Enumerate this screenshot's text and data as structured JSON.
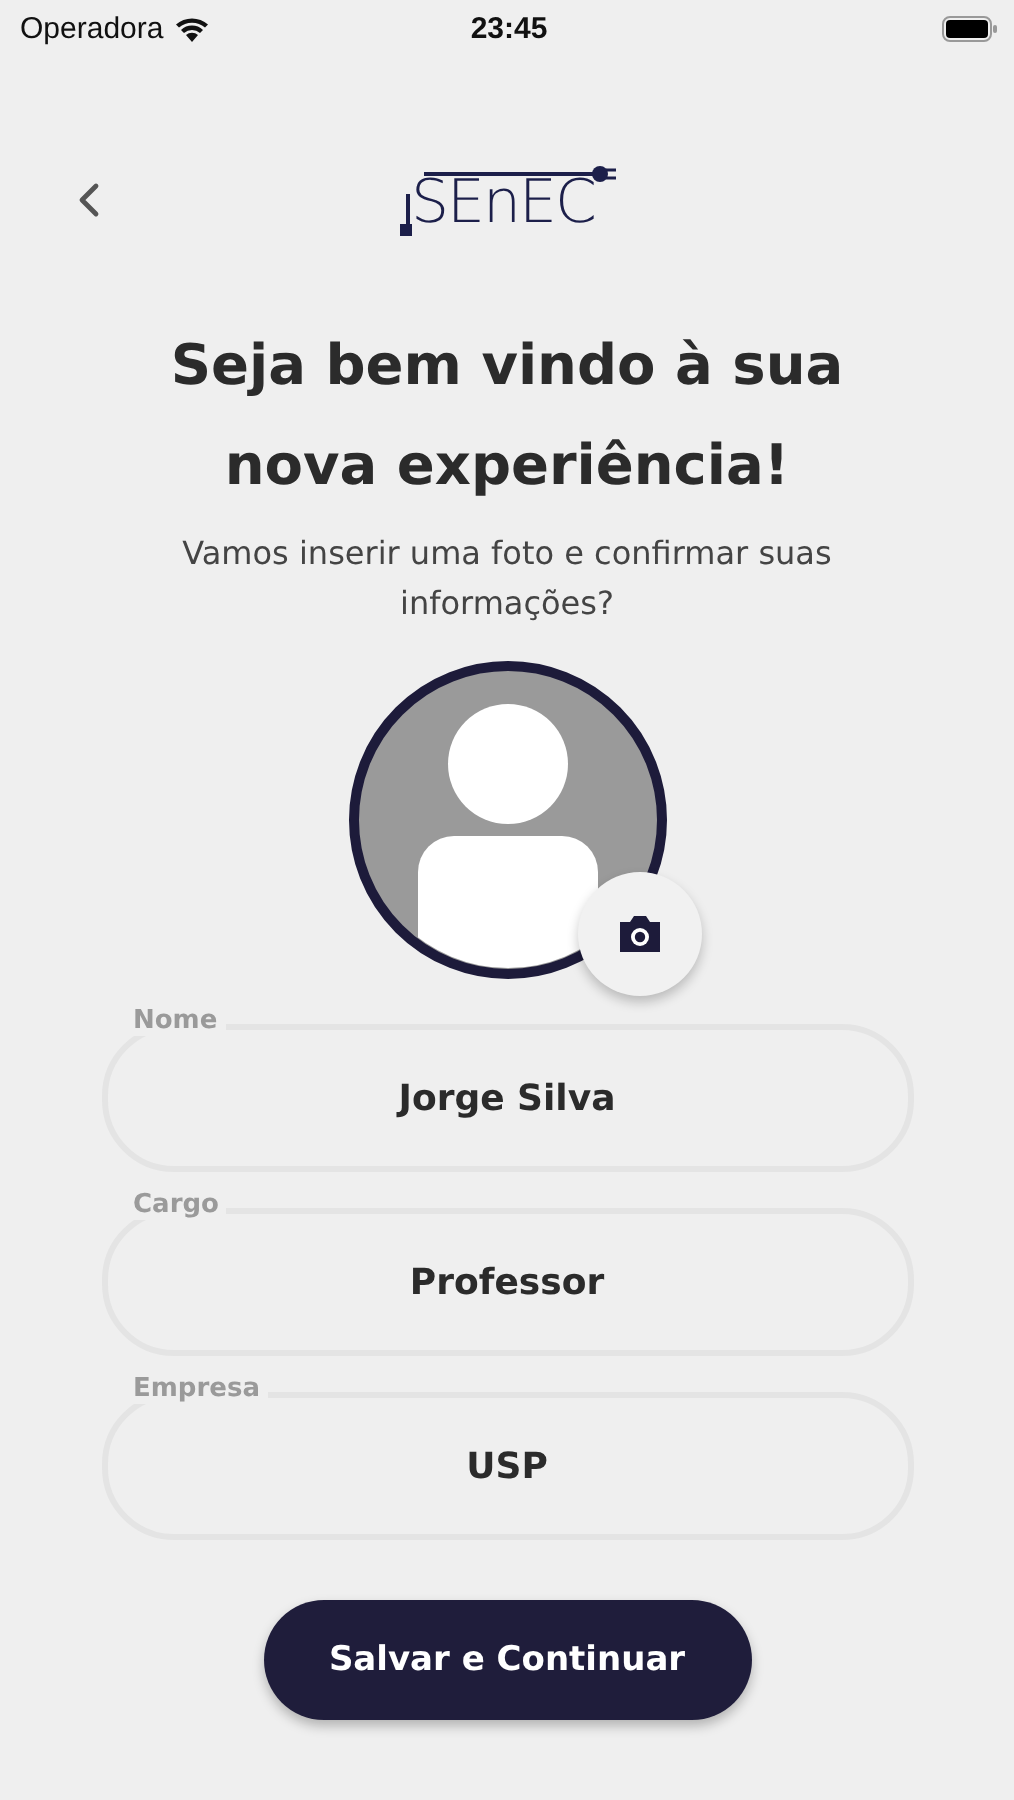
{
  "status_bar": {
    "carrier": "Operadora",
    "time": "23:45"
  },
  "header": {
    "logo": "SEnEC"
  },
  "title": "Seja bem vindo à sua nova experiência!",
  "subtitle": "Vamos inserir uma foto e confirmar suas informações?",
  "fields": [
    {
      "label": "Nome",
      "value": "Jorge Silva"
    },
    {
      "label": "Cargo",
      "value": "Professor"
    },
    {
      "label": "Empresa",
      "value": "USP"
    }
  ],
  "submit_button": "Salvar e Continuar"
}
